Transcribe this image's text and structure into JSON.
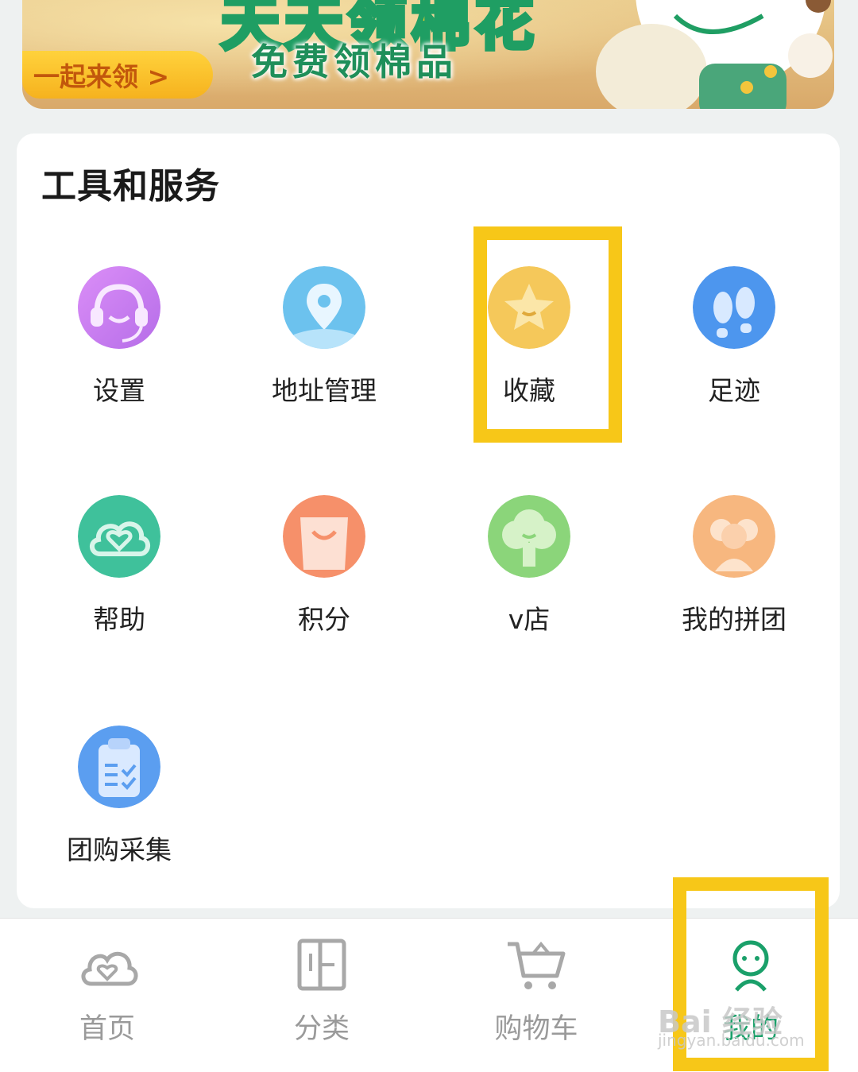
{
  "banner": {
    "headline": "天天领棉花",
    "subtitle": "免费领棉品",
    "cta": "一起来领 >"
  },
  "tools_section": {
    "title": "工具和服务",
    "items": [
      {
        "label": "设置",
        "icon": "customer-service-headset-icon",
        "color": "#c67cf0"
      },
      {
        "label": "地址管理",
        "icon": "location-pin-icon",
        "color": "#6cc2ee"
      },
      {
        "label": "收藏",
        "icon": "star-icon",
        "color": "#f5c85a"
      },
      {
        "label": "足迹",
        "icon": "footprints-icon",
        "color": "#4d96ee"
      },
      {
        "label": "帮助",
        "icon": "cloud-heart-icon",
        "color": "#3fc19b"
      },
      {
        "label": "积分",
        "icon": "shopping-bag-icon",
        "color": "#f6906a"
      },
      {
        "label": "v店",
        "icon": "shop-tree-icon",
        "color": "#8bd57a"
      },
      {
        "label": "我的拼团",
        "icon": "group-people-icon",
        "color": "#f7b77f"
      },
      {
        "label": "团购采集",
        "icon": "clipboard-checklist-icon",
        "color": "#5b9ef0"
      }
    ]
  },
  "bottom_nav": {
    "items": [
      {
        "label": "首页",
        "icon": "home-cloud-icon",
        "active": false
      },
      {
        "label": "分类",
        "icon": "category-icon",
        "active": false
      },
      {
        "label": "购物车",
        "icon": "shopping-cart-icon",
        "active": false
      },
      {
        "label": "我的",
        "icon": "profile-icon",
        "active": true
      }
    ]
  },
  "colors": {
    "accent": "#1aa06a",
    "highlight_box": "#f7c718",
    "page_bg": "#eef1f1"
  },
  "watermark": {
    "text": "Bai 经验",
    "sub": "jingyan.baidu.com"
  }
}
